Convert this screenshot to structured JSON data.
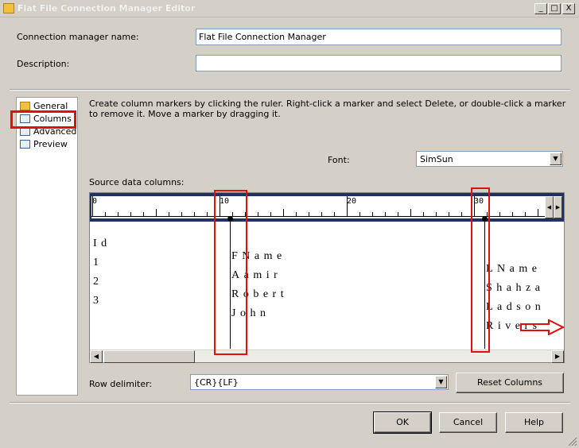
{
  "window": {
    "title": "Flat File Connection Manager Editor"
  },
  "titlebar_buttons": {
    "minimize": "_",
    "maximize": "□",
    "close": "X"
  },
  "form": {
    "name_label": "Connection manager name:",
    "name_value": "Flat File Connection Manager",
    "description_label": "Description:",
    "description_value": ""
  },
  "nav": {
    "items": [
      {
        "label": "General",
        "icon": "general-icon"
      },
      {
        "label": "Columns",
        "icon": "columns-icon",
        "selected": true
      },
      {
        "label": "Advanced",
        "icon": "advanced-icon"
      },
      {
        "label": "Preview",
        "icon": "preview-icon"
      }
    ]
  },
  "instructions": "Create column markers by clicking the ruler. Right-click a marker and select Delete, or double-click a marker to remove it. Move a marker by dragging it.",
  "font": {
    "label": "Font:",
    "value": "SimSun"
  },
  "source": {
    "label": "Source data columns:",
    "ruler_numbers": [
      "0",
      "10",
      "20",
      "30"
    ],
    "rows": [
      [
        "Id",
        "FName",
        "LName"
      ],
      [
        "1",
        "Aamir",
        "Shahza"
      ],
      [
        "2",
        "Robert",
        "Ladson"
      ],
      [
        "3",
        "John",
        "Rivers"
      ]
    ]
  },
  "row_delimiter": {
    "label": "Row delimiter:",
    "value": "{CR}{LF}"
  },
  "buttons": {
    "reset_columns": "Reset Columns",
    "ok": "OK",
    "cancel": "Cancel",
    "help": "Help"
  },
  "colors": {
    "highlight": "#e01010",
    "ruler_frame": "#1f3360"
  }
}
